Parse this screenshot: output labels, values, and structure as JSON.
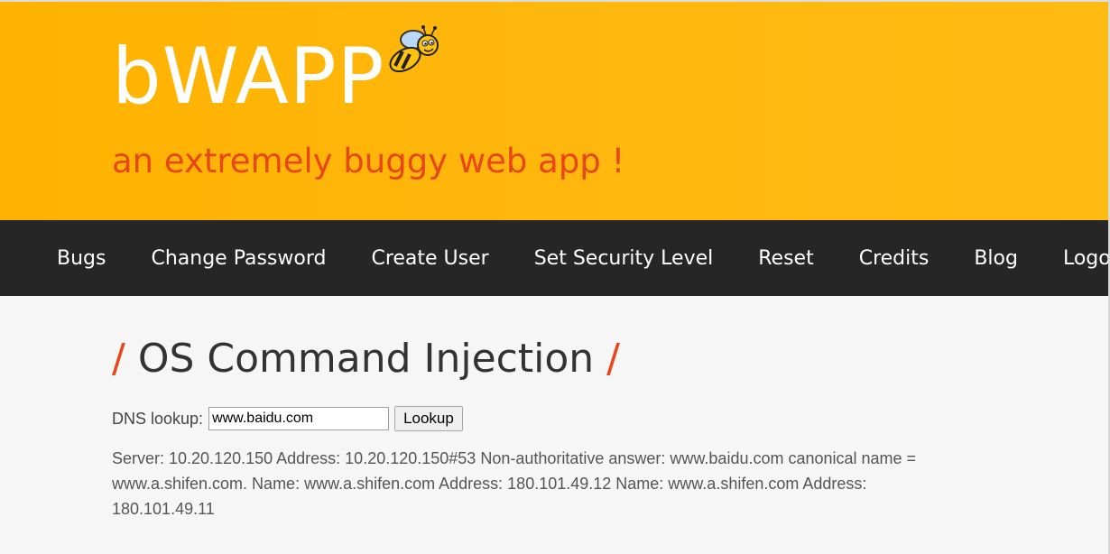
{
  "header": {
    "logo": "bWAPP",
    "tagline": "an extremely buggy web app !",
    "colors": {
      "background": "#ffb70d",
      "tagline": "#e8461b",
      "menu": "#262626"
    }
  },
  "menu": {
    "items": [
      "Bugs",
      "Change Password",
      "Create User",
      "Set Security Level",
      "Reset",
      "Credits",
      "Blog",
      "Logout"
    ]
  },
  "main": {
    "title_slash_left": "/",
    "title": "OS Command Injection",
    "title_slash_right": "/",
    "form": {
      "label": "DNS lookup:",
      "input_value": "www.baidu.com",
      "button_label": "Lookup"
    },
    "result_text": "Server: 10.20.120.150 Address: 10.20.120.150#53 Non-authoritative answer: www.baidu.com canonical name = www.a.shifen.com. Name: www.a.shifen.com Address: 180.101.49.12 Name: www.a.shifen.com Address: 180.101.49.11"
  },
  "icons": {
    "logo_mascot": "bee-icon"
  }
}
